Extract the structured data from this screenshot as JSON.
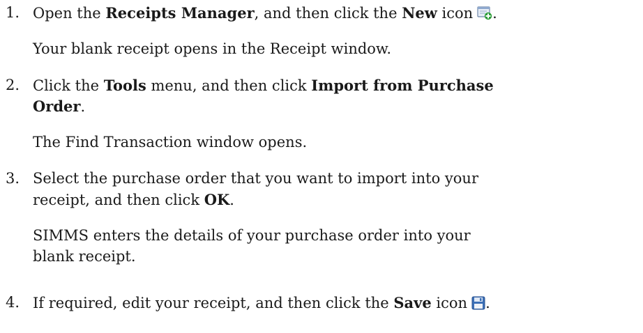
{
  "steps": [
    {
      "number": "1.",
      "part1": "Open the ",
      "bold1": "Receipts Manager",
      "part2": ", and then click the ",
      "bold2": "New",
      "part3": " icon",
      "part4": ".",
      "icon": "new-receipt-icon",
      "result": "Your blank receipt opens in the Receipt window."
    },
    {
      "number": "2.",
      "part1": "Click the ",
      "bold1": "Tools",
      "part2": " menu, and then click ",
      "bold2": "Import from Purchase",
      "bold2b": "Order",
      "part3": ".",
      "result": "The Find Transaction window opens."
    },
    {
      "number": "3.",
      "line1": "Select the purchase order that you want to import into your",
      "line2a": "receipt, and then click ",
      "bold1": "OK",
      "line2b": ".",
      "result_line1": "SIMMS enters the details of your purchase order into your",
      "result_line2": "blank receipt."
    },
    {
      "number": "4.",
      "part1": "If required, edit your receipt, and then click the ",
      "bold1": "Save",
      "part2": " icon",
      "part3": ".",
      "icon": "save-icon"
    }
  ],
  "colors": {
    "text": "#1a1a1a",
    "icon_blue": "#3b6fb6",
    "icon_green": "#2e9e3a"
  }
}
